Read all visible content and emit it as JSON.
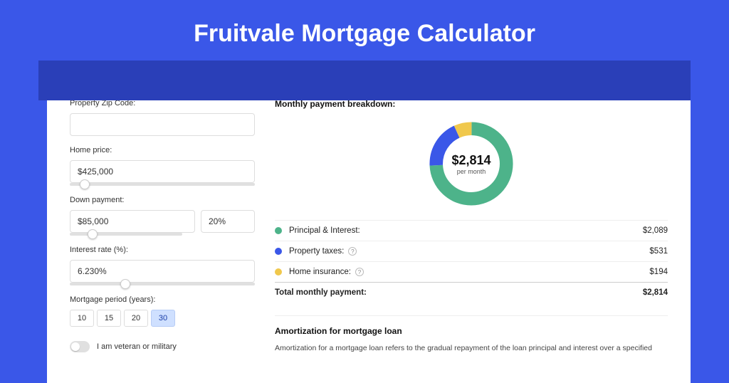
{
  "title": "Fruitvale Mortgage Calculator",
  "form": {
    "zip_label": "Property Zip Code:",
    "zip_value": "",
    "home_price_label": "Home price:",
    "home_price_value": "$425,000",
    "home_price_slider_pct": 8,
    "down_payment_label": "Down payment:",
    "down_payment_value": "$85,000",
    "down_payment_pct_value": "20%",
    "down_payment_slider_pct": 20,
    "interest_label": "Interest rate (%):",
    "interest_value": "6.230%",
    "interest_slider_pct": 30,
    "period_label": "Mortgage period (years):",
    "periods": [
      "10",
      "15",
      "20",
      "30"
    ],
    "period_selected": "30",
    "veteran_label": "I am veteran or military"
  },
  "breakdown": {
    "title": "Monthly payment breakdown:",
    "center_amount": "$2,814",
    "center_sub": "per month",
    "items": [
      {
        "label": "Principal & Interest:",
        "value": "$2,089"
      },
      {
        "label": "Property taxes:",
        "value": "$531"
      },
      {
        "label": "Home insurance:",
        "value": "$194"
      }
    ],
    "total_label": "Total monthly payment:",
    "total_value": "$2,814"
  },
  "amortization": {
    "title": "Amortization for mortgage loan",
    "text": "Amortization for a mortgage loan refers to the gradual repayment of the loan principal and interest over a specified"
  },
  "chart_data": {
    "type": "pie",
    "title": "Monthly payment breakdown",
    "series": [
      {
        "name": "Principal & Interest",
        "value": 2089,
        "color": "#4db38a"
      },
      {
        "name": "Property taxes",
        "value": 531,
        "color": "#3a57e8"
      },
      {
        "name": "Home insurance",
        "value": 194,
        "color": "#f0c84c"
      }
    ],
    "total": 2814
  }
}
